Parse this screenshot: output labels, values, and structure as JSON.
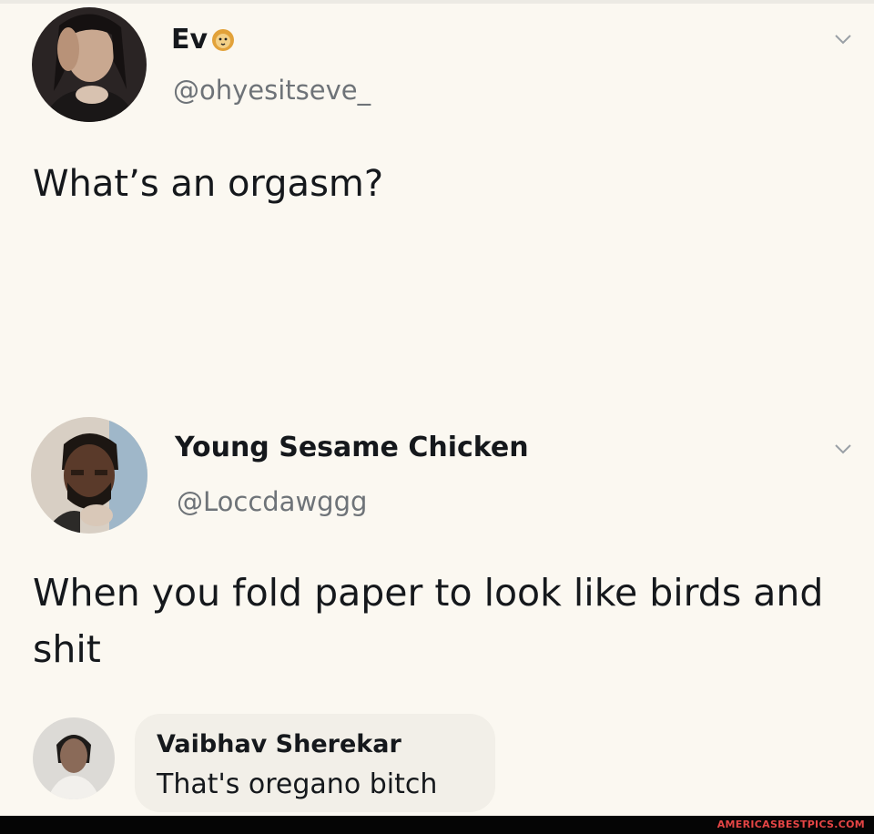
{
  "tweet1": {
    "display_name": "Ev",
    "badge_icon": "lion-face-icon",
    "handle": "@ohyesitseve_",
    "text": "What’s an orgasm?"
  },
  "tweet2": {
    "display_name": "Young Sesame Chicken",
    "handle": "@Loccdawggg",
    "text": "When you fold paper to look like birds and shit"
  },
  "comment": {
    "author": "Vaibhav Sherekar",
    "text": "That's oregano bitch"
  },
  "watermark": "AMERICASBESTPICS.COM",
  "colors": {
    "background": "#fbf8f1",
    "text": "#15181c",
    "handle": "#6e7378",
    "watermark": "#e44545"
  }
}
